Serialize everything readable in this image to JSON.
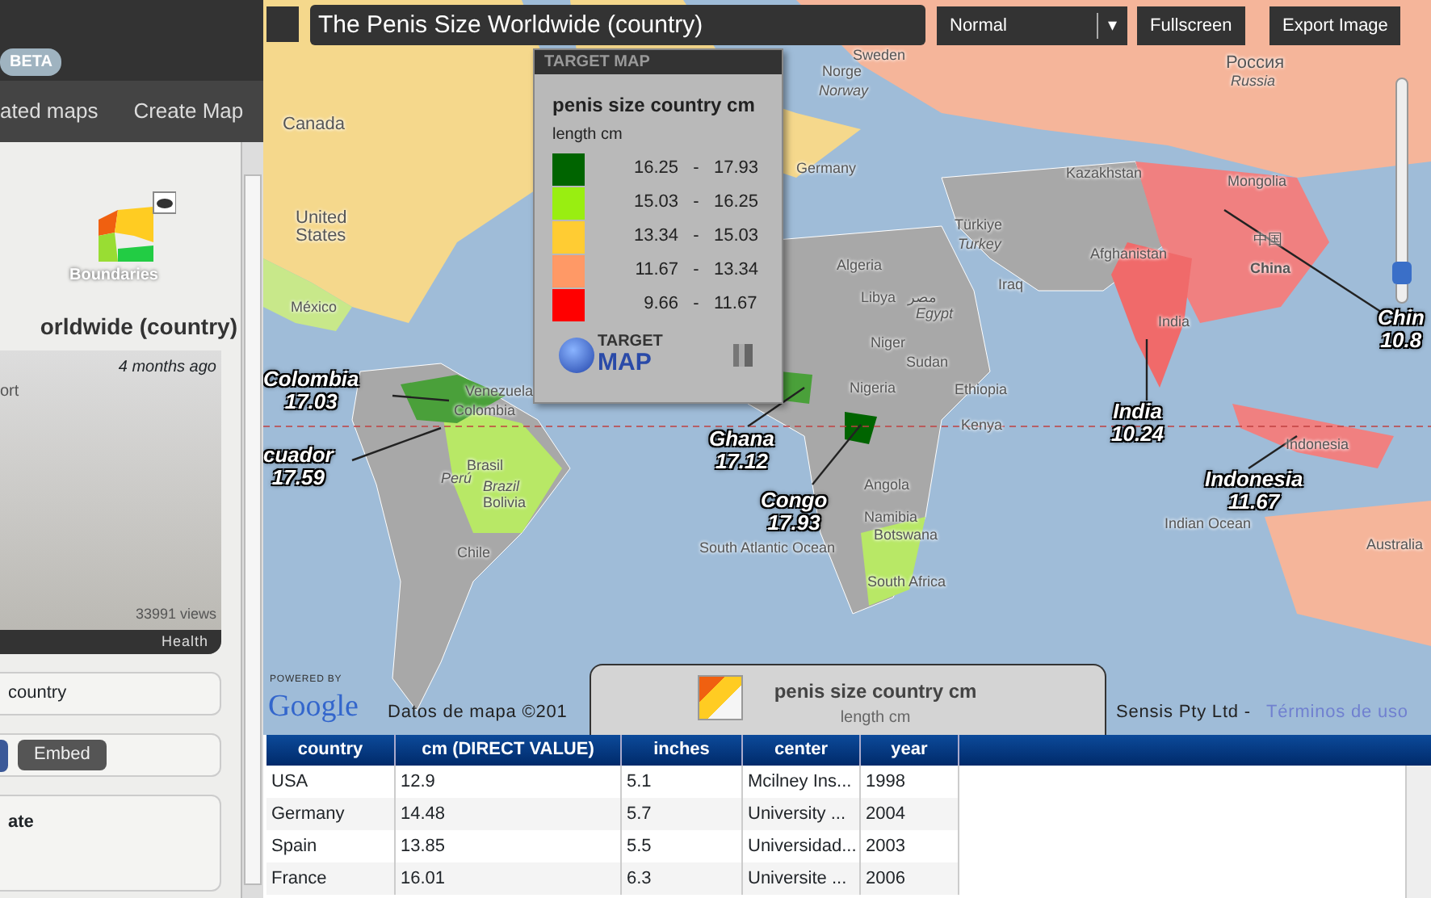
{
  "sidebar": {
    "badge": "BETA",
    "nav": [
      "ated maps",
      "Create Map"
    ],
    "category_tile": {
      "label": "Boundaries"
    },
    "map_title": "orldwide (country)",
    "card": {
      "age": "4 months ago",
      "excerpt": "ort",
      "views": "33991 views",
      "category": "Health"
    },
    "field": "country",
    "share": {
      "embed": "Embed"
    },
    "section": "ate"
  },
  "toolbar": {
    "title": "The Penis Size Worldwide (country)",
    "view_mode": "Normal",
    "caret": "▾",
    "buttons": [
      "Fullscreen",
      "Export Image"
    ]
  },
  "legend": {
    "header_logo": "TARGET MAP",
    "title": "penis size country cm",
    "subtitle": "length cm",
    "classes": [
      {
        "from": "16.25",
        "dash": "-",
        "to": "17.93",
        "color": "#006400"
      },
      {
        "from": "15.03",
        "dash": "-",
        "to": "16.25",
        "color": "#99ee11"
      },
      {
        "from": "13.34",
        "dash": "-",
        "to": "15.03",
        "color": "#ffcc33"
      },
      {
        "from": "11.67",
        "dash": "-",
        "to": "13.34",
        "color": "#ff9966"
      },
      {
        "from": "9.66",
        "dash": "-",
        "to": "11.67",
        "color": "#ff0000"
      }
    ],
    "logo_top": "TARGET",
    "logo_bottom": "MAP"
  },
  "map_labels": [
    "Canada",
    "United States",
    "México",
    "Venezuela",
    "Colombia",
    "Perú",
    "Brasil",
    "Brazil",
    "Bolivia",
    "Chile",
    "Россия",
    "Russia",
    "Norge",
    "Norway",
    "Sweden",
    "Germany",
    "Kazakhstan",
    "Mongolia",
    "中国",
    "China",
    "India",
    "Afghanistan",
    "Türkiye",
    "Turkey",
    "Libya",
    "مصر",
    "Egypt",
    "Niger",
    "Nigeria",
    "Sudan",
    "Ethiopia",
    "Kenya",
    "Angola",
    "Namibia",
    "Botswana",
    "South Africa",
    "South Atlantic Ocean",
    "Indian Ocean",
    "Australia",
    "Indonesia",
    "Iraq",
    "Algeria"
  ],
  "zoom": {
    "level": 0.1
  },
  "callouts": [
    {
      "name": "Colombia",
      "value": "17.03"
    },
    {
      "name": "cuador",
      "value": "17.59"
    },
    {
      "name": "Ghana",
      "value": "17.12"
    },
    {
      "name": "Congo",
      "value": "17.93"
    },
    {
      "name": "India",
      "value": "10.24"
    },
    {
      "name": "Indonesia",
      "value": "11.67"
    },
    {
      "name": "Chin",
      "value": "10.8"
    }
  ],
  "attribution": {
    "google_powered": "POWERED BY",
    "google": "Google",
    "map_data": "Datos de mapa ©201",
    "provider": "Sensis Pty Ltd - ",
    "terms": "Términos de uso"
  },
  "bottom_tab": {
    "title": "penis size country cm",
    "subtitle": "length cm"
  },
  "table": {
    "columns": [
      "country",
      "cm (DIRECT VALUE)",
      "inches",
      "center",
      "year"
    ],
    "rows": [
      [
        "USA",
        "12.9",
        "5.1",
        "Mcilney Ins...",
        "1998"
      ],
      [
        "Germany",
        "14.48",
        "5.7",
        "University ...",
        "2004"
      ],
      [
        "Spain",
        "13.85",
        "5.5",
        "Universidad...",
        "2003"
      ],
      [
        "France",
        "16.01",
        "6.3",
        "Universite ...",
        "2006"
      ]
    ]
  }
}
